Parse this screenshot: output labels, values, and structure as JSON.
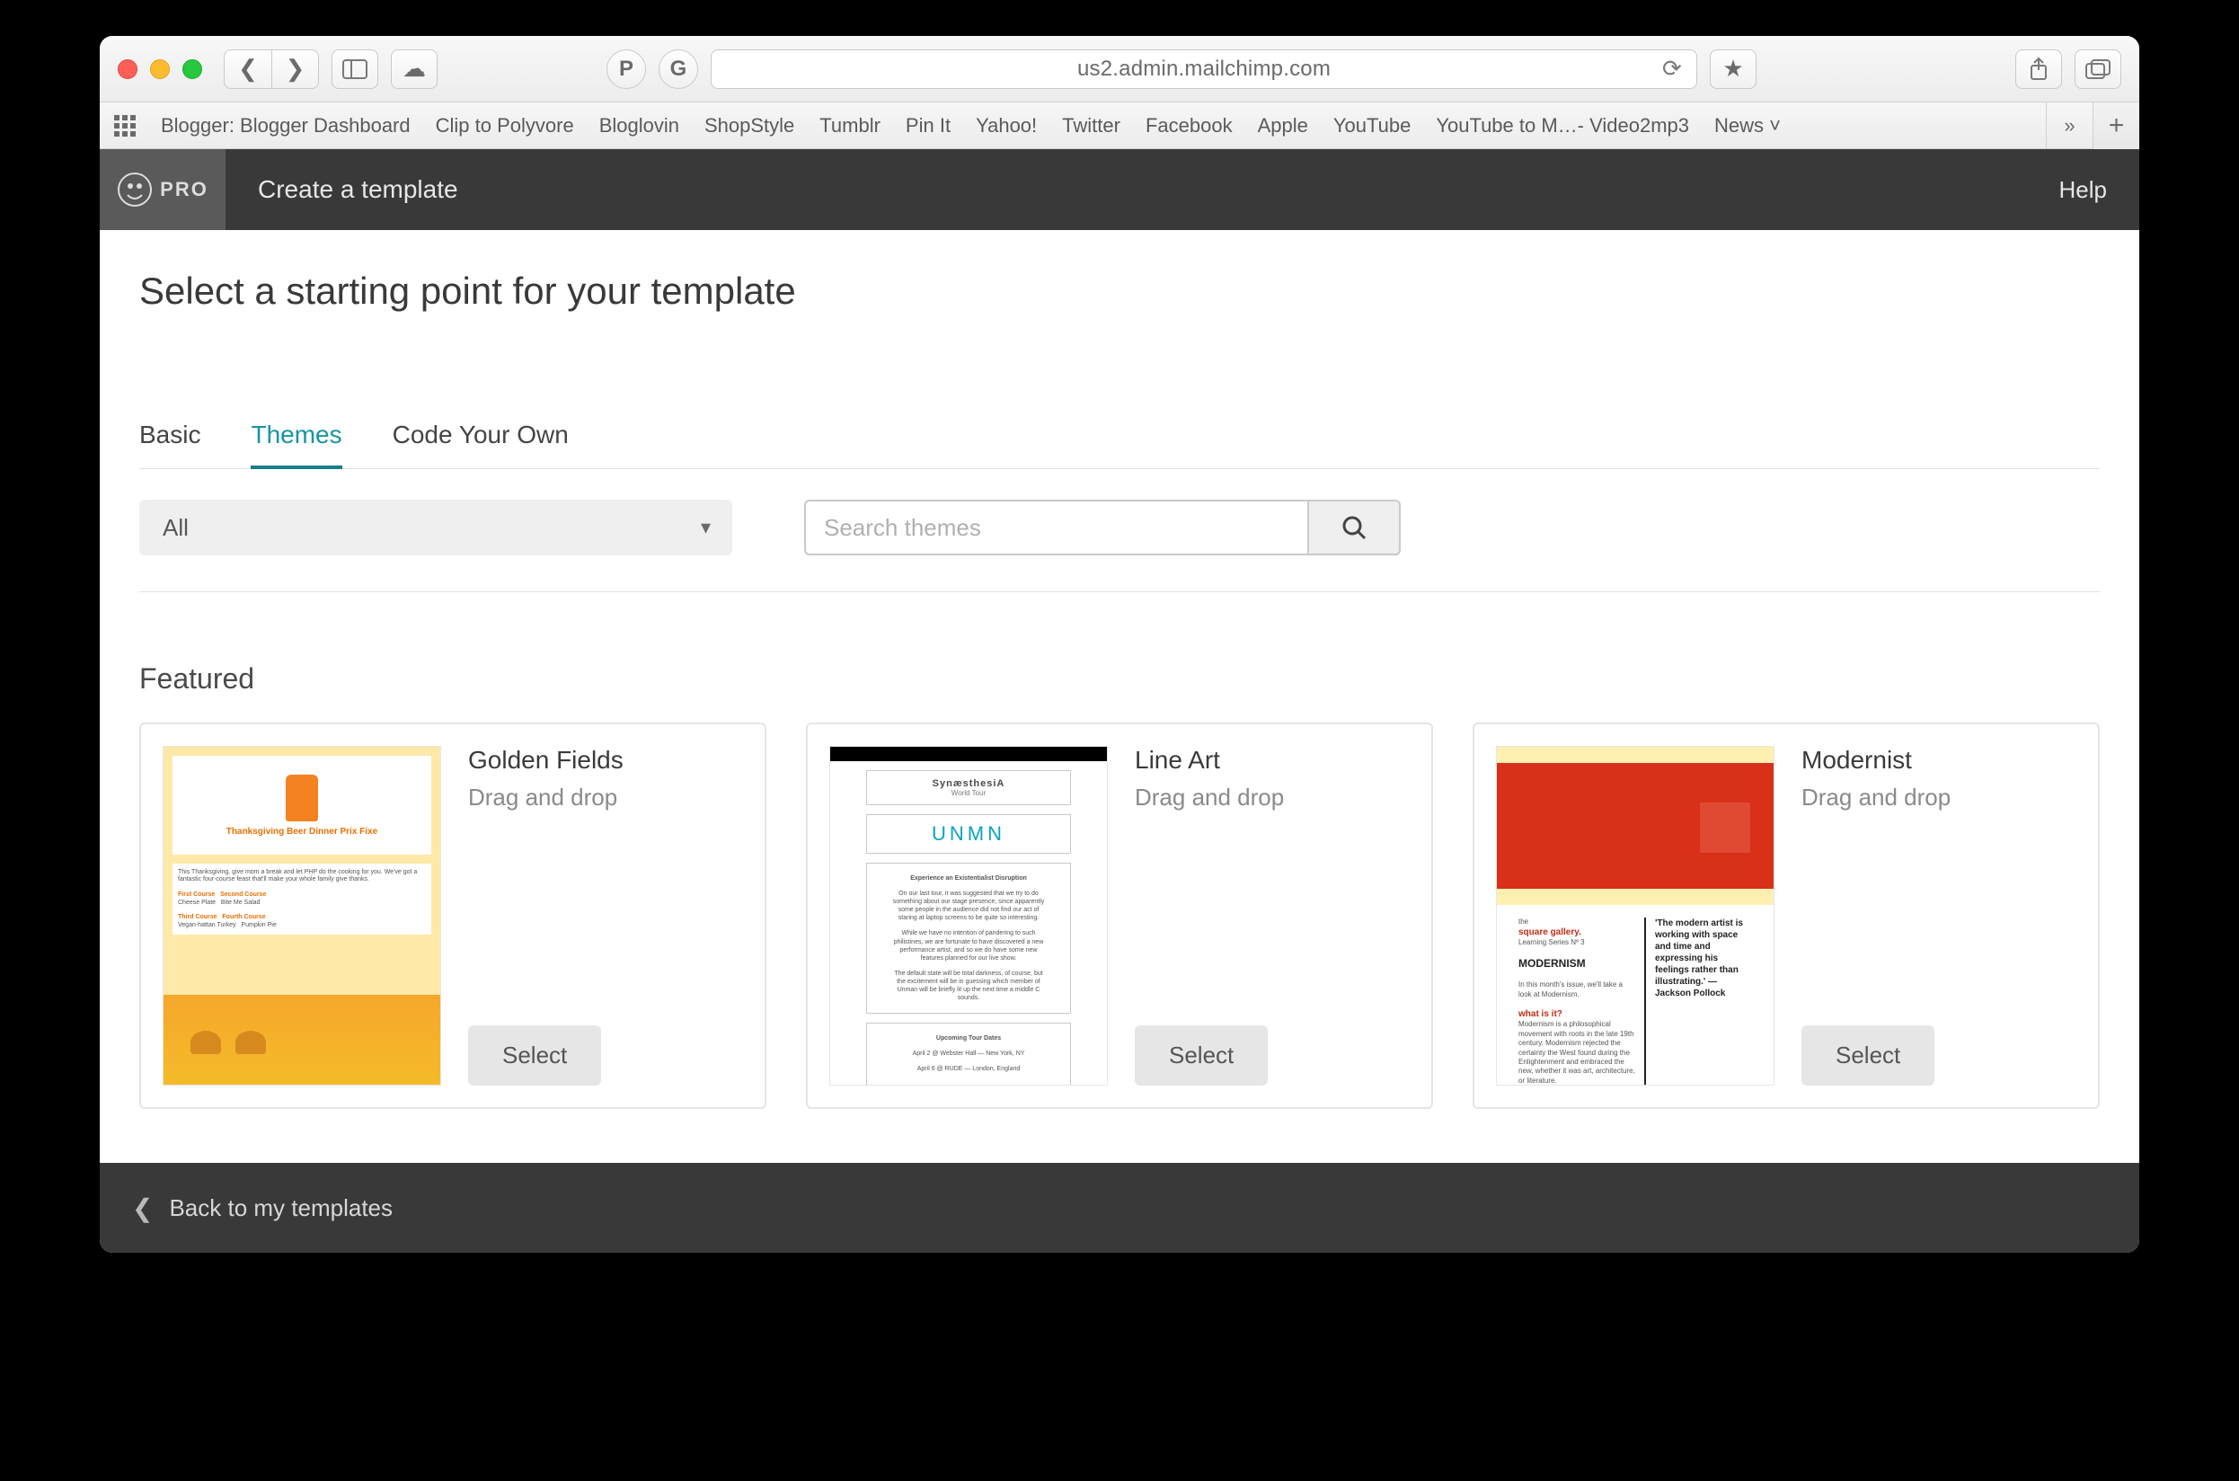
{
  "browser": {
    "url": "us2.admin.mailchimp.com",
    "bookmarks": [
      "Blogger: Blogger Dashboard",
      "Clip to Polyvore",
      "Bloglovin",
      "ShopStyle",
      "Tumblr",
      "Pin It",
      "Yahoo!",
      "Twitter",
      "Facebook",
      "Apple",
      "YouTube",
      "YouTube to M…- Video2mp3",
      "News"
    ]
  },
  "app": {
    "pro_label": "PRO",
    "title": "Create a template",
    "help": "Help"
  },
  "page": {
    "heading": "Select a starting point for your template",
    "tabs": [
      "Basic",
      "Themes",
      "Code Your Own"
    ],
    "active_tab": 1,
    "filter": {
      "selected": "All"
    },
    "search": {
      "placeholder": "Search themes"
    },
    "section": "Featured",
    "cards": [
      {
        "title": "Golden Fields",
        "subtitle": "Drag and drop",
        "button": "Select"
      },
      {
        "title": "Line Art",
        "subtitle": "Drag and drop",
        "button": "Select"
      },
      {
        "title": "Modernist",
        "subtitle": "Drag and drop",
        "button": "Select"
      }
    ]
  },
  "thumb_lineart": {
    "logo": "SynæsthesiA",
    "sub": "World Tour",
    "brand": "UNMN",
    "headline": "Experience an Existentialist Disruption",
    "tour": "Upcoming Tour Dates",
    "d1": "April 2 @ Webster Hall — New York, NY",
    "d2": "April 6 @ RUDE — London, England"
  },
  "thumb_modernist": {
    "gallery": "square gallery.",
    "series": "Learning Series Nº 3",
    "topic": "MODERNISM",
    "quote": "'The modern artist is working with space and time and expressing his feelings rather than illustrating.' — Jackson Pollock"
  },
  "thumb_golden": {
    "title": "Thanksgiving Beer Dinner Prix Fixe"
  },
  "footer": {
    "back": "Back to my templates"
  }
}
